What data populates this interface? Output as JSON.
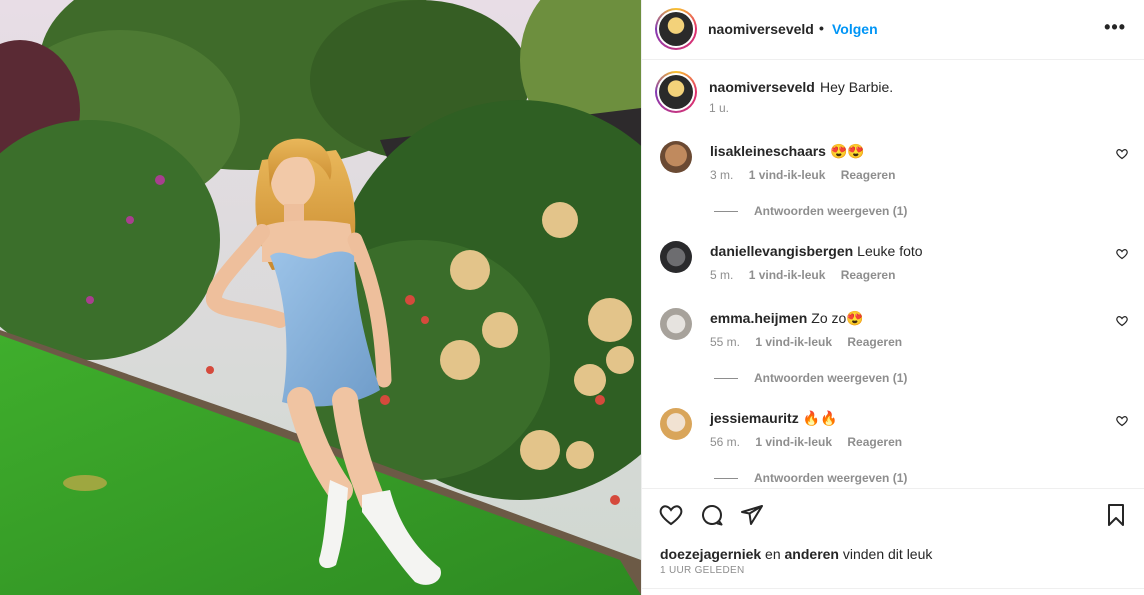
{
  "post": {
    "username": "naomiverseveld",
    "separator": "•",
    "follow_label": "Volgen",
    "more_label": "•••",
    "caption": "Hey Barbie.",
    "caption_time": "1 u."
  },
  "comments": [
    {
      "user": "lisakleineschaars",
      "text": "😍😍",
      "time": "3 m.",
      "likes": "1 vind-ik-leuk",
      "reply": "Reageren",
      "view_replies": "Antwoorden weergeven (1)"
    },
    {
      "user": "daniellevangisbergen",
      "text": "Leuke foto",
      "time": "5 m.",
      "likes": "1 vind-ik-leuk",
      "reply": "Reageren",
      "view_replies": ""
    },
    {
      "user": "emma.heijmen",
      "text": "Zo zo😍",
      "time": "55 m.",
      "likes": "1 vind-ik-leuk",
      "reply": "Reageren",
      "view_replies": "Antwoorden weergeven (1)"
    },
    {
      "user": "jessiemauritz",
      "text": "🔥🔥",
      "time": "56 m.",
      "likes": "1 vind-ik-leuk",
      "reply": "Reageren",
      "view_replies": "Antwoorden weergeven (1)"
    }
  ],
  "likes_line": {
    "user": "doezejagerniek",
    "en": "en",
    "others": "anderen",
    "suffix": "vinden dit leuk"
  },
  "post_time": "1 UUR GELEDEN",
  "icons": {
    "like": "heart-icon",
    "comment": "comment-bubble-icon",
    "share": "paper-plane-icon",
    "save": "bookmark-icon",
    "more": "more-dots-icon"
  },
  "colors": {
    "follow": "#0095f6",
    "meta": "#8e8e8e",
    "text": "#262626"
  }
}
